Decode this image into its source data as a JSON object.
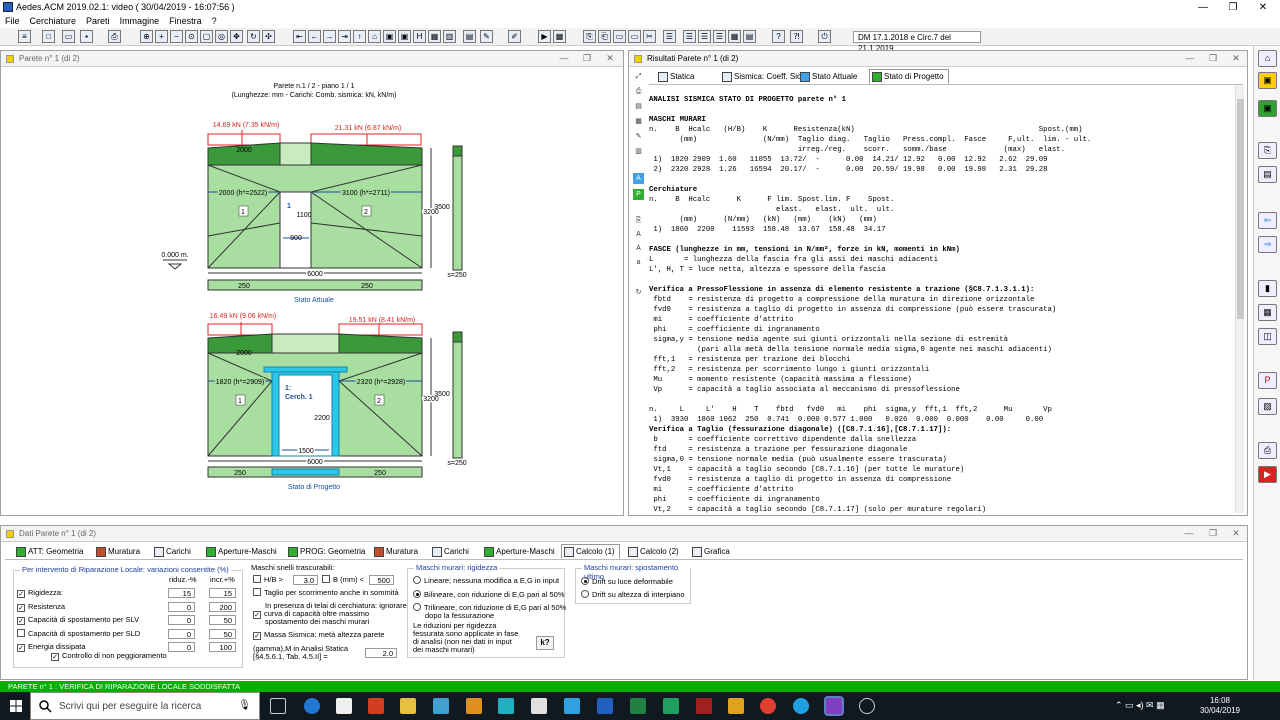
{
  "app": {
    "title": "Aedes.ACM 2019.02.1: video  ( 30/04/2019 - 16:07:56 )",
    "menu": [
      "File",
      "Cerchiature",
      "Pareti",
      "Immagine",
      "Finestra",
      "?"
    ],
    "norm_box": "DM 17.1.2018 e Circ.7 del 21.1.2019"
  },
  "left_window": {
    "title": "Parete n° 1 (di 2)",
    "drawing": {
      "header1": "Parete n.1 / 2 - piano 1 / 1",
      "header2": "(Lunghezze: mm - Carichi: Comb. sismica: kN, kN/m)",
      "level_label": "0.000 m.",
      "top": {
        "load_left": "14.69 kN (7.35 kN/m)",
        "load_right": "21.31 kN (6.87 kN/m)",
        "dim_2000_top": "2000",
        "dim_left": "2000 (h*=2522)",
        "dim_right": "3100 (h*=2711)",
        "dim_900": "900",
        "dim_1100": "1100",
        "dim_6000": "6000",
        "dim_3200": "3200",
        "dim_3500": "3500",
        "dim_s": "s=250",
        "b250_left": "250",
        "b250_right": "250",
        "pier1": "1",
        "pier2": "2",
        "open1": "1",
        "caption": "Stato Attuale"
      },
      "bottom": {
        "load_left": "16.49 kN (9.06 kN/m)",
        "load_right": "19.51 kN (8.41 kN/m)",
        "dim_2000_top": "2000",
        "dim_left": "1820 (h*=2909)",
        "dim_right": "2320 (h*=2928)",
        "dim_1500": "1500",
        "dim_2200": "2200",
        "dim_6000": "6000",
        "dim_3200": "3200",
        "dim_3500": "3500",
        "dim_s": "s=250",
        "b250_left": "250",
        "b250_right": "250",
        "pier1": "1",
        "pier2": "2",
        "open1": "1:",
        "open1b": "Cerch. 1",
        "caption": "Stato di Progetto"
      }
    }
  },
  "right_window": {
    "title": "Risultati Parete n° 1 (di 2)",
    "tabs": [
      "Statica",
      "Sismica: Coeff. Sic.",
      "Stato Attuale",
      "Stato di Progetto"
    ],
    "report": [
      {
        "t": "ANALISI SISMICA STATO DI PROGETTO parete n° 1",
        "b": true
      },
      {
        "t": ""
      },
      {
        "t": "MASCHI MURARI",
        "b": true
      },
      {
        "t": "n.    B  Hcalc   (H/B)    K      Resistenza(kN)                                          Spost.(mm)"
      },
      {
        "t": "       (mm)               (N/mm)  Taglio diag.   Taglio   Press.compl.  Fasce     F,ult.  lim. - ult."
      },
      {
        "t": "                                  irreg./reg.    scorr.   somm./base             (max)   elast."
      },
      {
        "t": " 1)  1820 2909  1.60   11055  13.72/  -      0.00  14.21/ 12.92   0.00  12.92   2.62  29.09"
      },
      {
        "t": " 2)  2320 2928  1.26   16594  20.17/  -      0.00  20.59/ 19.98   0.00  19.98   2.31  29.28"
      },
      {
        "t": ""
      },
      {
        "t": "Cerchiature",
        "b": true
      },
      {
        "t": "n.    B  Hcalc      K      F lim. Spost.lim. F    Spost."
      },
      {
        "t": "                             elast.   elast.  ult.  ult."
      },
      {
        "t": "       (mm)      (N/mm)   (kN)   (mm)    (kN)   (mm)"
      },
      {
        "t": " 1)  1860  2200    11593  158.48  13.67  158.48  34.17"
      },
      {
        "t": ""
      },
      {
        "t": "FASCE (lunghezze in mm, tensioni in N/mm², forze in kN, momenti in kNm)",
        "b": true
      },
      {
        "t": "L       = lunghezza della fascia fra gli assi dei maschi adiacenti"
      },
      {
        "t": "L', H, T = luce netta, altezza e spessore della fascia"
      },
      {
        "t": ""
      },
      {
        "t": "Verifica a PressoFlessione in assenza di elemento resistente a trazione (§C8.7.1.3.1.1):",
        "b": true
      },
      {
        "t": " fbtd    = resistenza di progetto a compressione della muratura in direzione orizzontale"
      },
      {
        "t": " fvd0    = resistenza a taglio di progetto in assenza di compressione (può essere trascurata)"
      },
      {
        "t": " mi      = coefficiente d'attrito"
      },
      {
        "t": " phi     = coefficiente di ingranamento"
      },
      {
        "t": " sigma,y = tensione media agente sui giunti orizzontali nella sezione di estremità"
      },
      {
        "t": "           (pari alla metà della tensione normale media sigma,0 agente nei maschi adiacenti)"
      },
      {
        "t": " fft,1   = resistenza per trazione dei blocchi"
      },
      {
        "t": " fft,2   = resistenza per scorrimento lungo i giunti orizzontali"
      },
      {
        "t": " Mu      = momento resistente (capacità massima a flessione)"
      },
      {
        "t": " Vp      = capacità a taglio associata al meccanismo di pressoflessione"
      },
      {
        "t": ""
      },
      {
        "t": "n.     L     L'    H    T    fbtd   fvd0   mi    phi  sigma,y  fft,1  fft,2      Mu       Vp"
      },
      {
        "t": " 1)  3930  1860 1062  250  0.741  0.000 0.577 1.000   0.026  0.000  0.000    0.00     0.00"
      },
      {
        "t": "Verifica a Taglio (fessurazione diagonale) ([C8.7.1.16],[C8.7.1.17]):",
        "b": true
      },
      {
        "t": " b       = coefficiente correttivo dipendente dalla snellezza"
      },
      {
        "t": " ftd     = resistenza a trazione per fessurazione diagonale"
      },
      {
        "t": " sigma,0 = tensione normale media (può usualmente essere trascurata)"
      },
      {
        "t": " Vt,1    = capacità a taglio secondo [C8.7.1.16] (per tutte le murature)"
      },
      {
        "t": " fvd0    = resistenza a taglio di progetto in assenza di compressione"
      },
      {
        "t": " mi      = coefficiente d'attrito"
      },
      {
        "t": " phi     = coefficiente di ingranamento"
      },
      {
        "t": " Vt,2    = capacità a taglio secondo [C8.7.1.17] (solo per murature regolari)"
      }
    ]
  },
  "bottom_window": {
    "title": "Dati Parete n° 1 (di 2)",
    "tabs": [
      "ATT: Geometria",
      "Muratura",
      "Carichi",
      "Aperture-Maschi",
      "PROG: Geometria",
      "Muratura",
      "Carichi",
      "Aperture-Maschi",
      "Calcolo (1)",
      "Calcolo (2)",
      "Grafica"
    ],
    "group1": {
      "title": "Per intervento di Riparazione Locale: variazioni consentite (%)",
      "col1": "riduz.-%",
      "col2": "incr.+%",
      "rows": [
        {
          "label": "Rigidezza:",
          "checked": true,
          "riduz": "15",
          "incr": "15"
        },
        {
          "label": "Resistenza",
          "checked": true,
          "riduz": "0",
          "incr": "200"
        },
        {
          "label": "Capacità di spostamento per SLV",
          "checked": true,
          "riduz": "0",
          "incr": "50"
        },
        {
          "label": "Capacità di spostamento per SLD",
          "checked": false,
          "riduz": "0",
          "incr": "50"
        },
        {
          "label": "Energia dissipata",
          "checked": true,
          "riduz": "0",
          "incr": "100"
        }
      ],
      "controllo": "Controllo di non peggioramento"
    },
    "group2": {
      "title": "Maschi snelli trascurabili:",
      "hb_label": "H/B >",
      "hb_value": "3.0",
      "b_label": "B (mm) <",
      "b_value": "500",
      "taglio": "Taglio per scorrimento anche in sommità",
      "telai1": "In presenza di telai di cerchiatura: ignorare",
      "telai2": "curva di capacità oltre massimo",
      "telai3": "spostamento dei maschi murari",
      "massa": "Massa Sismica: metà altezza parete",
      "gamma1": "(gamma),M in Analisi Statica",
      "gamma2": "[§4.5.6.1, Tab. 4.5.II] =",
      "gamma_value": "2.0"
    },
    "group3": {
      "title": "Maschi murari: rigidezza",
      "opt1": "Lineare; nessuna modifica a E,G in input",
      "opt2": "Bilineare, con riduzione di E,G pari al 50%",
      "opt3a": "Trilineare, con riduzione di E,G pari al 50%",
      "opt3b": "dopo la fessurazione",
      "note1": "Le riduzioni per rigidezza",
      "note2": "fessurata sono applicate in fase",
      "note3": "di analisi (non nei dati in input",
      "note4": "dei maschi murari)",
      "help": "k?"
    },
    "group4": {
      "title": "Maschi murari: spostamento ultimo",
      "opt1": "Drift su luce deformabile",
      "opt2": "Drift su altezza di interpiano"
    }
  },
  "status_text": "PARETE n° 1 : VERIFICA DI RIPARAZIONE LOCALE SODDISFATTA",
  "taskbar": {
    "search_placeholder": "Scrivi qui per eseguire la ricerca",
    "time": "16:08",
    "date": "30/04/2019"
  }
}
